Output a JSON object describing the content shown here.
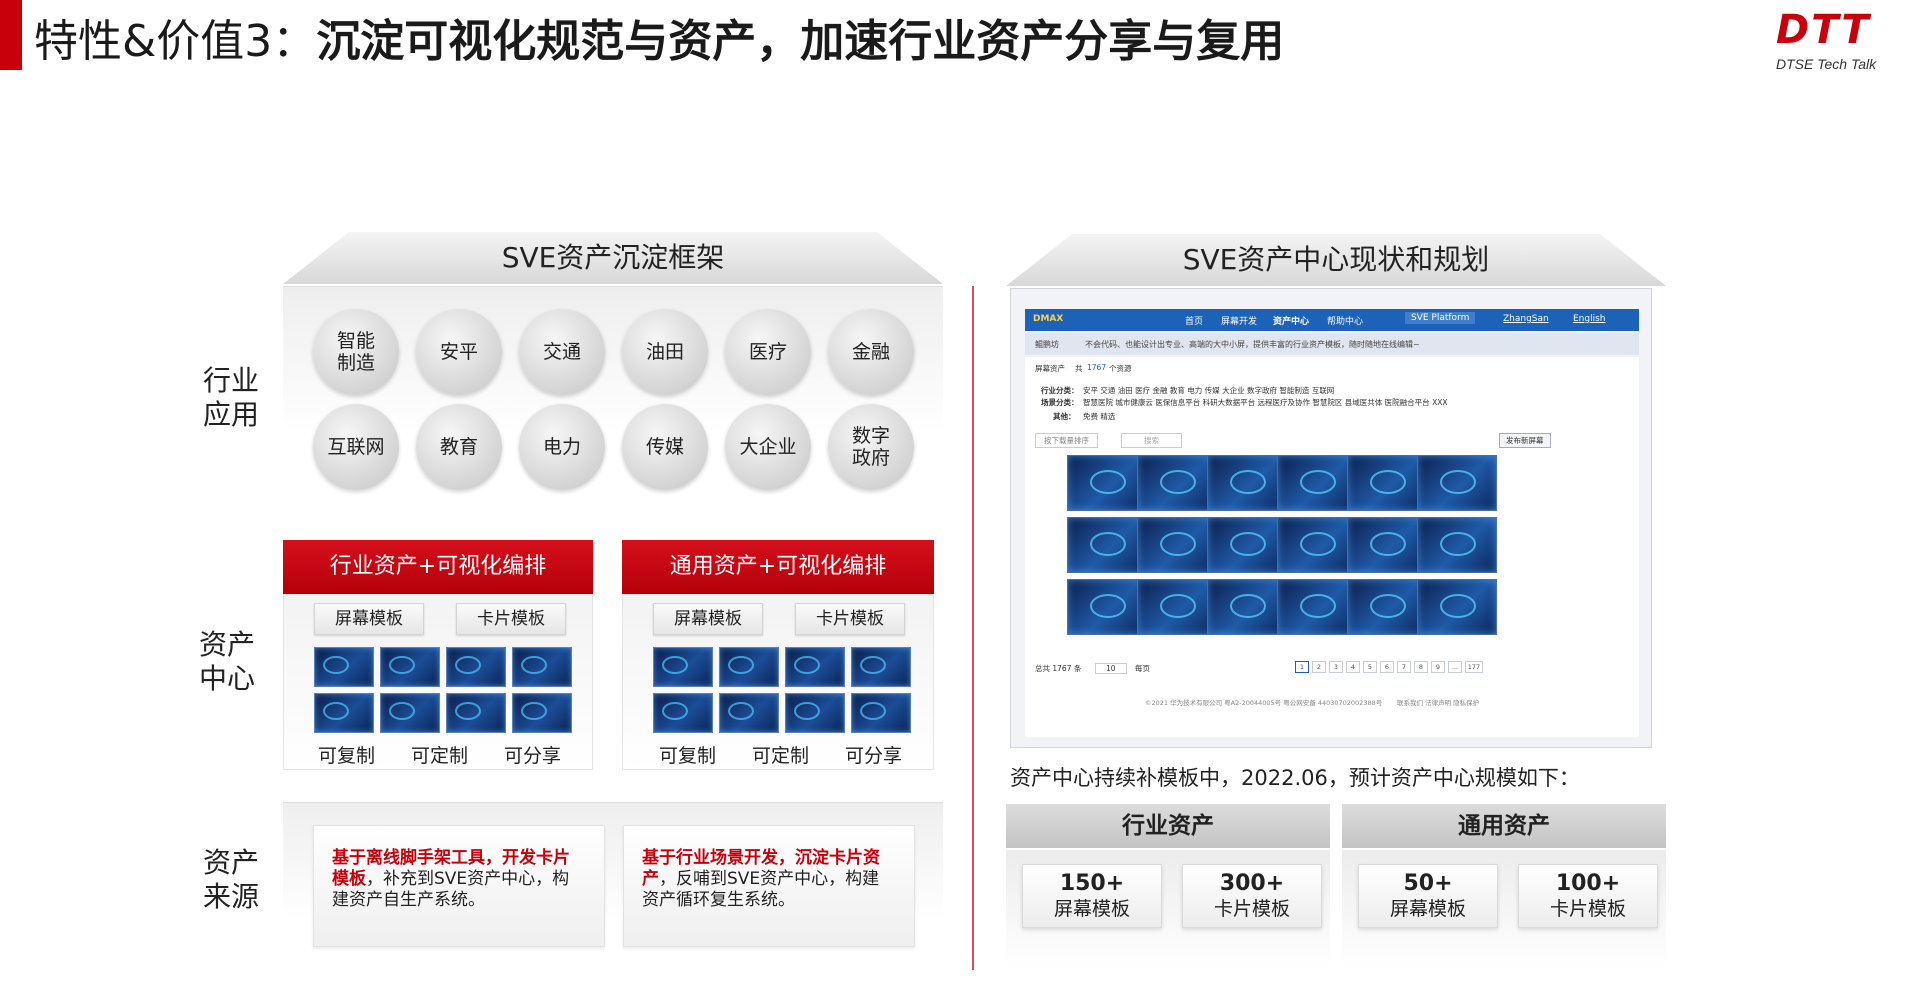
{
  "header": {
    "title_prefix": "特性&价值3：",
    "title_main": "沉淀可视化规范与资产，加速行业资产分享与复用",
    "logo_mark": "DTT",
    "logo_sub": "DTSE Tech Talk"
  },
  "left": {
    "section_title": "SVE资产沉淀框架",
    "row_industry": "行业\n应用",
    "row_center": "资产\n中心",
    "row_source": "资产\n来源",
    "industries": [
      "智能\n制造",
      "安平",
      "交通",
      "油田",
      "医疗",
      "金融",
      "互联网",
      "教育",
      "电力",
      "传媒",
      "大企业",
      "数字\n政府"
    ],
    "panels": [
      {
        "title": "行业资产+可视化编排",
        "tab1": "屏幕模板",
        "tab2": "卡片模板",
        "caps": [
          "可复制",
          "可定制",
          "可分享"
        ]
      },
      {
        "title": "通用资产+可视化编排",
        "tab1": "屏幕模板",
        "tab2": "卡片模板",
        "caps": [
          "可复制",
          "可定制",
          "可分享"
        ]
      }
    ],
    "sources": [
      {
        "highlight": "基于离线脚手架工具，开发卡片模板",
        "text": "，补充到SVE资产中心，构建资产自生产系统。"
      },
      {
        "highlight": "基于行业场景开发，沉淀卡片资产",
        "text": "，反哺到SVE资产中心，构建资产循环复生系统。"
      }
    ]
  },
  "right": {
    "section_title": "SVE资产中心现状和规划",
    "screenshot": {
      "brand": "DMAX",
      "nav": [
        "首页",
        "屏幕开发",
        "资产中心",
        "帮助中心"
      ],
      "nav_search": "SVE Platform",
      "user": "ZhangSan",
      "lang": "English",
      "sub_tag": "鲲鹏坊",
      "sub_text": "不会代码、也能设计出专业、高端的大中小屏，提供丰富的行业资产模板，随时随地在线编辑~",
      "crumb": "屏幕资产",
      "count_prefix": "共",
      "count": "1767",
      "count_suffix": "个资源",
      "filter_industry_label": "行业分类：",
      "filter_industry": "安平  交通  油田  医疗  金融  教育  电力  传媒  大企业  数字政府  智能制造  互联网",
      "filter_scene_label": "场景分类：",
      "filter_scene": "智慧医院   城市健康云   医保信息平台   科研大数据平台   远程医疗及协作   智慧院区   县域医共体   医院融合平台   XXX",
      "filter_other_label": "其他：",
      "filter_other": "免费   精选",
      "sort": "按下载量排序",
      "search_placeholder": "搜索",
      "publish": "发布新屏幕",
      "total": "总共 1767 条",
      "per_page": "10",
      "per_page_unit": "每页",
      "pages": [
        "1",
        "2",
        "3",
        "4",
        "5",
        "6",
        "7",
        "8",
        "9",
        "...",
        "177"
      ],
      "footer": "©2021 华为技术有限公司   粤A2-20044005号   粤公网安备 44030702002388号",
      "footer_links": "联系我们   法律声明   隐私保护"
    },
    "plan_text": "资产中心持续补模板中，2022.06，预计资产中心规模如下：",
    "plans": [
      {
        "title": "行业资产",
        "items": [
          {
            "num": "150+",
            "label": "屏幕模板"
          },
          {
            "num": "300+",
            "label": "卡片模板"
          }
        ]
      },
      {
        "title": "通用资产",
        "items": [
          {
            "num": "50+",
            "label": "屏幕模板"
          },
          {
            "num": "100+",
            "label": "卡片模板"
          }
        ]
      }
    ]
  }
}
